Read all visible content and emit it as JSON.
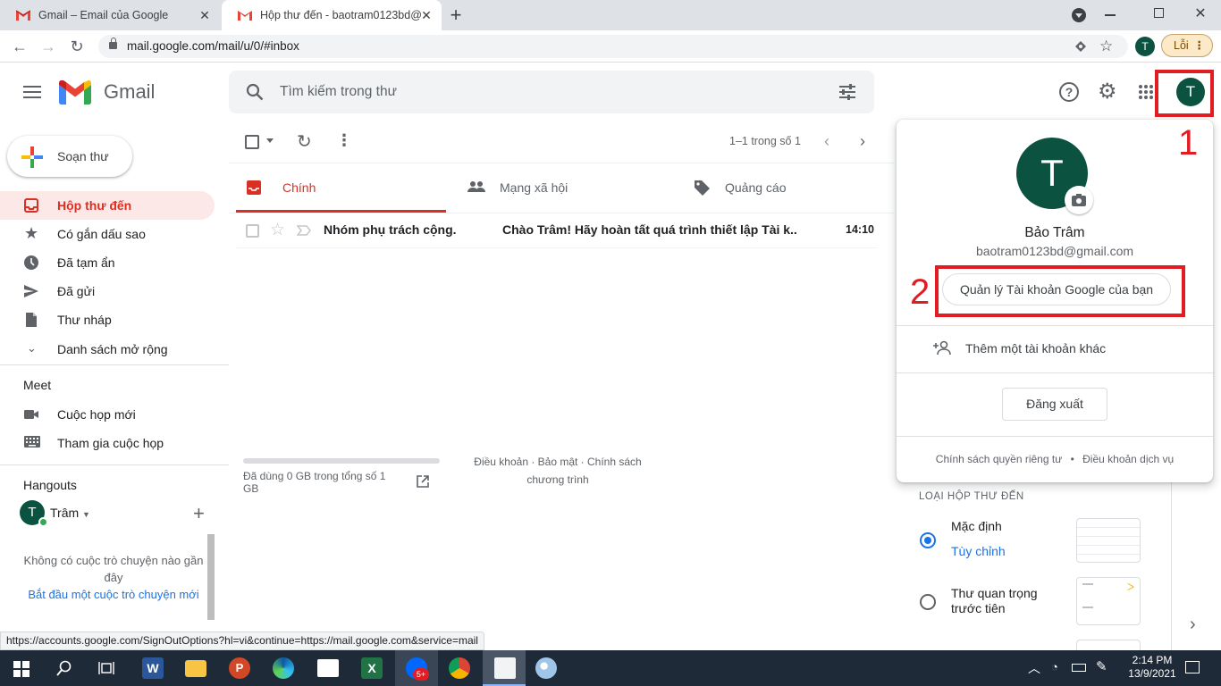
{
  "browser": {
    "tabs": [
      {
        "title": "Gmail – Email của Google",
        "active": false
      },
      {
        "title": "Hộp thư đến - baotram0123bd@",
        "active": true
      }
    ],
    "url": "mail.google.com/mail/u/0/#inbox",
    "profile_initial": "T",
    "error_label": "Lỗi"
  },
  "gmail": {
    "logo_text": "Gmail",
    "search_placeholder": "Tìm kiếm trong thư",
    "avatar_initial": "T",
    "compose_label": "Soạn thư",
    "nav": [
      {
        "label": "Hộp thư đến",
        "icon": "inbox-icon",
        "active": true
      },
      {
        "label": "Có gắn dấu sao",
        "icon": "star-icon"
      },
      {
        "label": "Đã tạm ẩn",
        "icon": "clock-icon"
      },
      {
        "label": "Đã gửi",
        "icon": "send-icon"
      },
      {
        "label": "Thư nháp",
        "icon": "draft-icon"
      },
      {
        "label": "Danh sách mở rộng",
        "icon": "chevron-down-icon"
      }
    ],
    "meet": {
      "title": "Meet",
      "items": [
        {
          "label": "Cuộc họp mới",
          "icon": "video-icon"
        },
        {
          "label": "Tham gia cuộc họp",
          "icon": "keyboard-icon"
        }
      ]
    },
    "hangouts": {
      "title": "Hangouts",
      "user": "Trâm",
      "user_initial": "T",
      "empty_text": "Không có cuộc trò chuyện nào gần đây",
      "start_link": "Bắt đầu một cuộc trò chuyện mới"
    },
    "toolbar": {
      "pagination": "1–1 trong số 1"
    },
    "tabs": [
      {
        "label": "Chính",
        "icon": "inbox-icon",
        "active": true
      },
      {
        "label": "Mạng xã hội",
        "icon": "people-icon"
      },
      {
        "label": "Quảng cáo",
        "icon": "tag-icon"
      }
    ],
    "messages": [
      {
        "sender": "Nhóm phụ trách cộng.",
        "subject": "Chào Trâm! Hãy hoàn tất quá trình thiết lập Tài k...",
        "time": "14:10"
      }
    ],
    "footer": {
      "storage": "Đã dùng 0 GB trong tổng số 1 GB",
      "storage_used_fraction": 0,
      "terms": "Điều khoản · Bảo mật · Chính sách chương trình"
    }
  },
  "account_popup": {
    "initial": "T",
    "name": "Bảo Trâm",
    "email": "baotram0123bd@gmail.com",
    "manage_button": "Quản lý Tài khoản Google của bạn",
    "add_account": "Thêm một tài khoản khác",
    "signout": "Đăng xuất",
    "privacy": "Chính sách quyền riêng tư",
    "dot": "•",
    "terms": "Điều khoản dịch vụ"
  },
  "inbox_type": {
    "title": "LOẠI HỘP THƯ ĐẾN",
    "default_label": "Mặc định",
    "customize": "Tùy chỉnh",
    "priority": "Thư quan trọng trước tiên"
  },
  "annotations": {
    "label1": "1",
    "label2": "2",
    "color": "#e21c23"
  },
  "status_bar": "https://accounts.google.com/SignOutOptions?hl=vi&continue=https://mail.google.com&service=mail",
  "taskbar": {
    "time": "2:14 PM",
    "date": "13/9/2021",
    "zalo_badge": "5+"
  }
}
